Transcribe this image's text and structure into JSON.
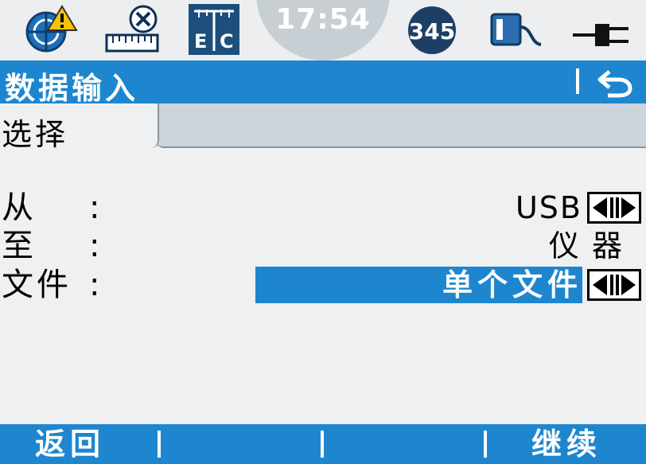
{
  "statusbar": {
    "clock": "17:54",
    "face_badge": "345",
    "ec_label_e": "E",
    "ec_label_c": "C",
    "icons": [
      "target-warning-icon",
      "ruler-cancel-icon",
      "ec-mode-icon",
      "face-indicator-icon",
      "battery-plug-icon",
      "power-plug-icon"
    ]
  },
  "title": {
    "text": "数据输入"
  },
  "tabs": [
    {
      "label": "选择",
      "active": true
    }
  ],
  "form": {
    "rows": [
      {
        "label": "从",
        "colon": ":",
        "value": "USB"
      },
      {
        "label": "至",
        "colon": ":",
        "value": "仪 器"
      },
      {
        "label": "文件",
        "colon": ":",
        "value": "单个文件"
      }
    ]
  },
  "softkeys": {
    "f1": "返回",
    "f4": "继续"
  },
  "colors": {
    "accent": "#1e86cf",
    "tab_inactive": "#cdd5dc",
    "background": "#eef0f1"
  }
}
